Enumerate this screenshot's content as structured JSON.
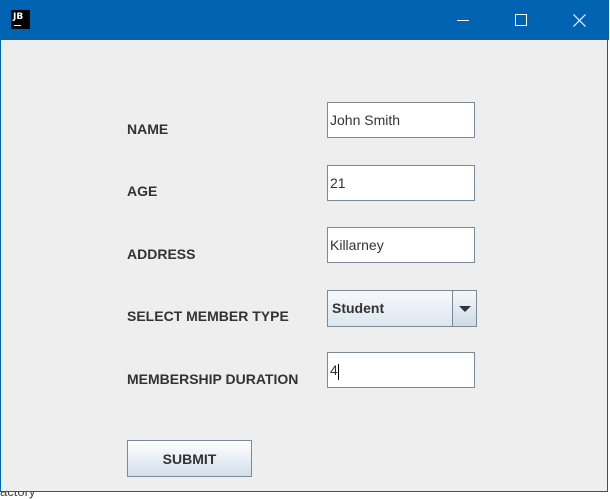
{
  "window": {
    "app_icon_text": "JB",
    "controls": {
      "minimize_icon": "minimize-icon",
      "maximize_icon": "maximize-icon",
      "close_icon": "close-icon"
    },
    "title_color": "#0063b1"
  },
  "form": {
    "name": {
      "label": "NAME",
      "value": "John Smith"
    },
    "age": {
      "label": "AGE",
      "value": "21"
    },
    "address": {
      "label": "ADDRESS",
      "value": "Killarney"
    },
    "member_type": {
      "label": "SELECT MEMBER TYPE",
      "selected": "Student"
    },
    "duration": {
      "label": "MEMBERSHIP DURATION",
      "value": "4"
    },
    "submit_label": "SUBMIT"
  },
  "background": {
    "partial_text": "actory"
  }
}
